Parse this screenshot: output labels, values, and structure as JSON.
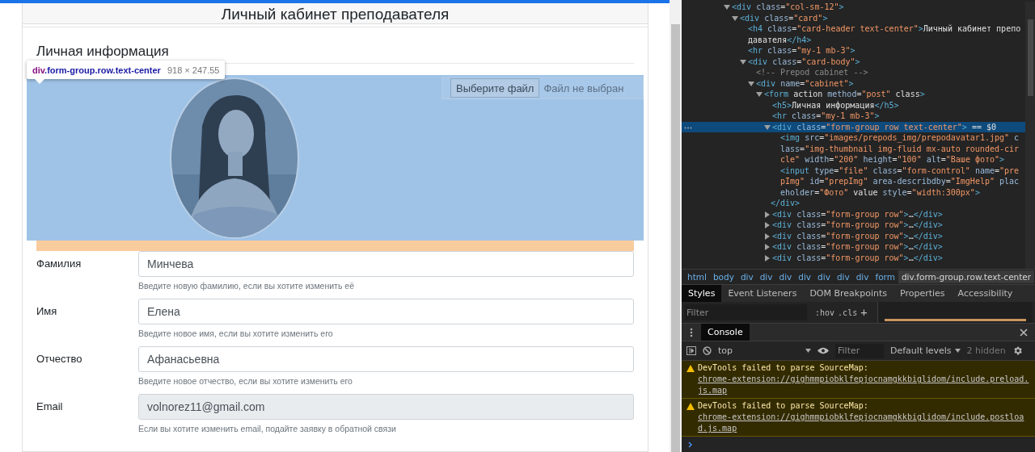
{
  "page": {
    "card_title": "Личный кабинет преподавателя",
    "section_heading": "Личная информация",
    "inspect_tooltip": {
      "selector": "div.form-group.row.text-center",
      "size": "918 × 247.55"
    },
    "file_input": {
      "button": "Выберите файл",
      "status": "Файл не выбран"
    },
    "fields": [
      {
        "label": "Фамилия",
        "value": "Минчева",
        "hint": "Введите новую фамилию, если вы хотите изменить её",
        "disabled": false
      },
      {
        "label": "Имя",
        "value": "Елена",
        "hint": "Введите новое имя, если вы хотите изменить его",
        "disabled": false
      },
      {
        "label": "Отчество",
        "value": "Афанасьевна",
        "hint": "Введите новое отчество, если вы хотите изменить его",
        "disabled": false
      },
      {
        "label": "Email",
        "value": "volnorez11@gmail.com",
        "hint": "Если вы хотите изменить email, подайте заявку в обратной связи",
        "disabled": true
      }
    ]
  },
  "devtools": {
    "dom_tree": [
      {
        "text": "<div class=\"col-sm-12\">",
        "expanded": true,
        "selected": false,
        "children": [
          {
            "text": "<div class=\"card\">",
            "expanded": true,
            "selected": false,
            "children": [
              {
                "text": "<h4 class=\"card-header text-center\">Личный кабинет преподавателя</h4>",
                "selected": false
              },
              {
                "text": "<hr class=\"my-1 mb-3\">",
                "selected": false
              },
              {
                "text": "<div class=\"card-body\">",
                "expanded": true,
                "selected": false,
                "children": [
                  {
                    "text": "<!-- Prepod cabinet -->",
                    "selected": false
                  },
                  {
                    "text": "<div name=\"cabinet\">",
                    "expanded": true,
                    "selected": false,
                    "children": [
                      {
                        "text": "<form action method=\"post\" class>",
                        "expanded": true,
                        "selected": false,
                        "children": [
                          {
                            "text": "<h5>Личная информация</h5>",
                            "selected": false
                          },
                          {
                            "text": "<hr class=\"my-1 mb-3\">",
                            "selected": false
                          },
                          {
                            "text": "<div class=\"form-group row text-center\"> == $0",
                            "expanded": true,
                            "selected": true,
                            "closing": "</div>",
                            "children": [
                              {
                                "text": "<img src=\"images/prepods_img/prepodavatar1.jpg\" class=\"img-thumbnail img-fluid mx-auto rounded-circle\" width=\"200\" height=\"100\" alt=\"Ваше фото\">",
                                "selected": false
                              },
                              {
                                "text": "<input type=\"file\" class=\"form-control\" name=\"prepImg\" id=\"prepImg\" area-describdby=\"ImgHelp\" placeholder=\"Фото\" value style=\"width:300px\">",
                                "selected": false
                              }
                            ]
                          },
                          {
                            "text": "<div class=\"form-group row\">…</div>",
                            "expanded": false,
                            "selected": false
                          },
                          {
                            "text": "<div class=\"form-group row\">…</div>",
                            "expanded": false,
                            "selected": false
                          },
                          {
                            "text": "<div class=\"form-group row\">…</div>",
                            "expanded": false,
                            "selected": false
                          },
                          {
                            "text": "<div class=\"form-group row\">…</div>",
                            "expanded": false,
                            "selected": false
                          },
                          {
                            "text": "<div class=\"form-group row\">…</div>",
                            "expanded": false,
                            "selected": false
                          }
                        ]
                      }
                    ]
                  }
                ]
              }
            ]
          }
        ]
      }
    ],
    "breadcrumbs": [
      {
        "label": "html",
        "selected": false
      },
      {
        "label": "body",
        "selected": false
      },
      {
        "label": "div",
        "selected": false
      },
      {
        "label": "div",
        "selected": false
      },
      {
        "label": "div",
        "selected": false
      },
      {
        "label": "div",
        "selected": false
      },
      {
        "label": "div",
        "selected": false
      },
      {
        "label": "div",
        "selected": false
      },
      {
        "label": "div",
        "selected": false
      },
      {
        "label": "form",
        "selected": false
      },
      {
        "label": "div.form-group.row.text-center",
        "selected": true
      }
    ],
    "tabs": [
      {
        "label": "Styles",
        "selected": true
      },
      {
        "label": "Event Listeners",
        "selected": false
      },
      {
        "label": "DOM Breakpoints",
        "selected": false
      },
      {
        "label": "Properties",
        "selected": false
      },
      {
        "label": "Accessibility",
        "selected": false
      }
    ],
    "styles_filter": {
      "placeholder": "Filter",
      "hov": ":hov",
      "cls": ".cls",
      "add": "+"
    },
    "drawer_tabs": [
      {
        "label": "Console",
        "selected": true
      }
    ],
    "console_toolbar": {
      "context": "top",
      "filter_placeholder": "Filter",
      "levels": "Default levels",
      "hidden": "2 hidden"
    },
    "messages": [
      {
        "kind": "warning",
        "text": "DevTools failed to parse SourceMap:",
        "link": "chrome-extension://gighmmpiobklfepjocnamgkkbiglidom/include.preload.js.map"
      },
      {
        "kind": "warning",
        "text": "DevTools failed to parse SourceMap:",
        "link": "chrome-extension://gighmmpiobklfepjocnamgkkbiglidom/include.postload.js.map"
      }
    ]
  }
}
